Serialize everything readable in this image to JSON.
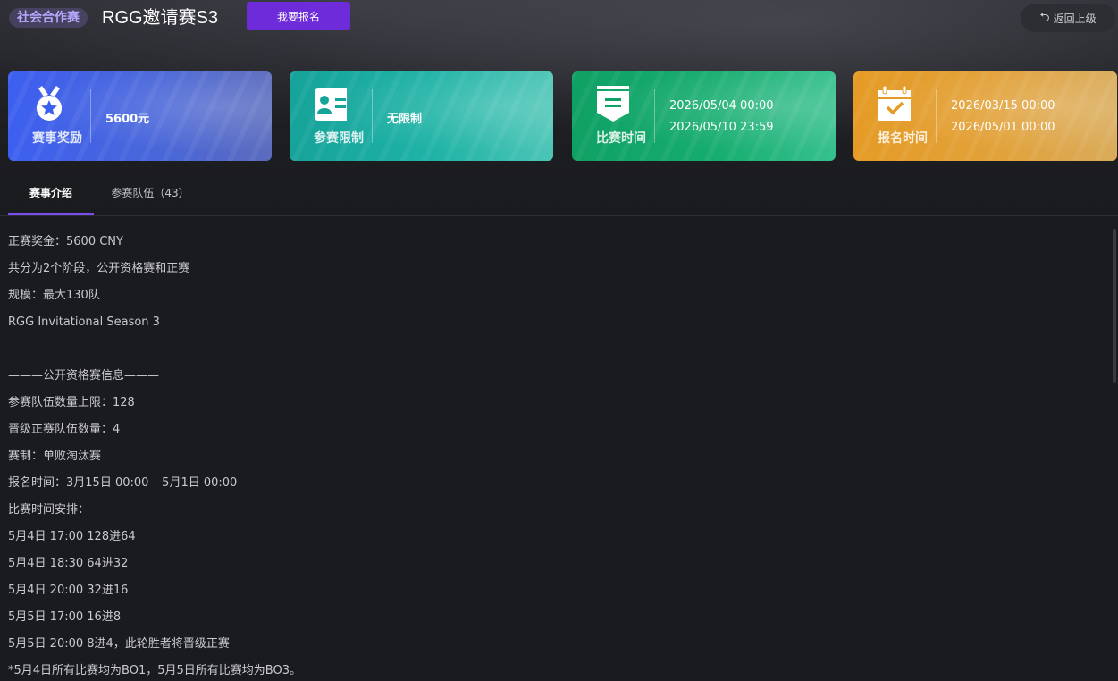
{
  "header": {
    "badge": "社会合作赛",
    "title": "RGG邀请赛S3",
    "signup_label": "我要报名",
    "back_label": "返回上级"
  },
  "cards": [
    {
      "label": "赛事奖励",
      "value": "5600元",
      "icon": "medal-icon",
      "color": "#3d5ff0"
    },
    {
      "label": "参赛限制",
      "value": "无限制",
      "icon": "id-card-icon",
      "color": "#16a39a"
    },
    {
      "label": "比赛时间",
      "start": "2026/05/04 00:00",
      "end": "2026/05/10 23:59",
      "icon": "flag-icon",
      "color": "#0fa064"
    },
    {
      "label": "报名时间",
      "start": "2026/03/15 00:00",
      "end": "2026/05/01 00:00",
      "icon": "calendar-check-icon",
      "color": "#e59b26"
    }
  ],
  "tabs": [
    {
      "label": "赛事介绍",
      "active": true
    },
    {
      "label": "参赛队伍（43）",
      "active": false
    }
  ],
  "accent_color": "#7b4cf0",
  "content_lines": [
    "正赛奖金：5600 CNY",
    "共分为2个阶段，公开资格赛和正赛",
    "规模：最大130队",
    "RGG Invitational Season 3",
    "",
    "———公开资格赛信息———",
    "参赛队伍数量上限：128",
    "晋级正赛队伍数量：4",
    "赛制：单败淘汰赛",
    "报名时间：3月15日 00:00 – 5月1日 00:00",
    "比赛时间安排：",
    "5月4日 17:00 128进64",
    "5月4日 18:30 64进32",
    "5月4日 20:00 32进16",
    "5月5日 17:00 16进8",
    "5月5日 20:00 8进4，此轮胜者将晋级正赛",
    "*5月4日所有比赛均为BO1，5月5日所有比赛均为BO3。"
  ]
}
